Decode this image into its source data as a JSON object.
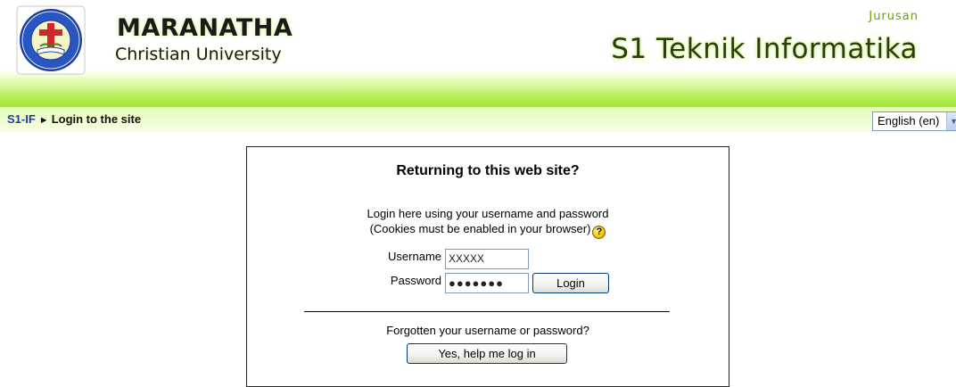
{
  "header": {
    "university_name": "MARANATHA",
    "university_subtitle": "Christian University",
    "department_label": "Jurusan",
    "department_name": "S1 Teknik Informatika",
    "accent_color": "#9fe532"
  },
  "nav": {
    "breadcrumb_home": "S1-IF",
    "breadcrumb_separator": "►",
    "breadcrumb_current": "Login to the site",
    "language_selected": "English (en)"
  },
  "login": {
    "title": "Returning to this web site?",
    "intro_line1": "Login here using your username and password",
    "intro_line2": "(Cookies must be enabled in your browser)",
    "help_icon": "help-icon",
    "username_label": "Username",
    "username_value": "XXXXX",
    "password_label": "Password",
    "password_value": "●●●●●●●",
    "login_button": "Login",
    "forgot_text": "Forgotten your username or password?",
    "help_button": "Yes, help me log in"
  }
}
